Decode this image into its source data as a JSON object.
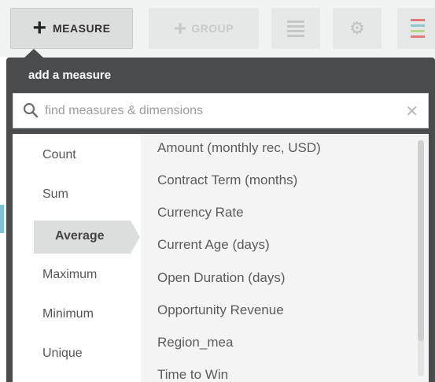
{
  "toolbar": {
    "measure_label": "MEASURE",
    "group_label": "GROUP",
    "accent_colors": [
      "#e07a7a",
      "#8fc7d0",
      "#b7d88c"
    ]
  },
  "dropdown": {
    "title": "add a measure",
    "search": {
      "placeholder": "find measures & dimensions",
      "value": ""
    },
    "aggregations": [
      {
        "label": "Count",
        "selected": false
      },
      {
        "label": "Sum",
        "selected": false
      },
      {
        "label": "Average",
        "selected": true
      },
      {
        "label": "Maximum",
        "selected": false
      },
      {
        "label": "Minimum",
        "selected": false
      },
      {
        "label": "Unique",
        "selected": false
      }
    ],
    "fields": [
      "Amount (monthly rec, USD)",
      "Contract Term (months)",
      "Currency Rate",
      "Current Age (days)",
      "Open Duration (days)",
      "Opportunity Revenue",
      "Region_mea",
      "Time to Win"
    ],
    "icons": {
      "search": "search-icon",
      "clear": "close-icon"
    }
  }
}
